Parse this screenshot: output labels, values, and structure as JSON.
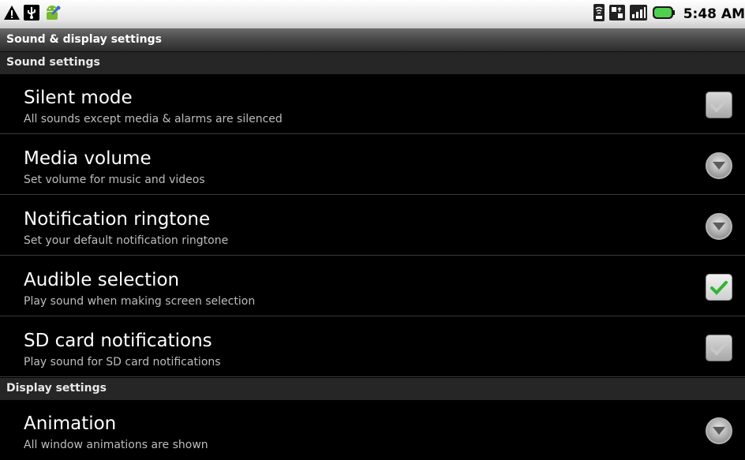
{
  "status_bar": {
    "left_icons": [
      "warning-icon",
      "usb-debug-icon",
      "android-icon"
    ],
    "right_icons": [
      "wifi-icon",
      "data-transfer-icon",
      "signal-icon",
      "battery-icon"
    ],
    "time": "5:48 AM"
  },
  "title_bar": {
    "title": "Sound & display settings"
  },
  "sound_section": {
    "header": "Sound settings",
    "items": [
      {
        "title": "Silent mode",
        "summary": "All sounds except media & alarms are silenced",
        "widget": "checkbox",
        "checked": false
      },
      {
        "title": "Media volume",
        "summary": "Set volume for music and videos",
        "widget": "arrow-button"
      },
      {
        "title": "Notification ringtone",
        "summary": "Set your default notification ringtone",
        "widget": "arrow-button"
      },
      {
        "title": "Audible selection",
        "summary": "Play sound when making screen selection",
        "widget": "checkbox",
        "checked": true
      },
      {
        "title": "SD card notifications",
        "summary": "Play sound for SD card notifications",
        "widget": "checkbox",
        "checked": false
      }
    ]
  },
  "display_section": {
    "header": "Display settings",
    "items": [
      {
        "title": "Animation",
        "summary": "All window animations are shown",
        "widget": "arrow-button"
      }
    ]
  },
  "colors": {
    "accent_check": "#2fb52f",
    "background": "#000000",
    "category_bg": "#262626"
  }
}
